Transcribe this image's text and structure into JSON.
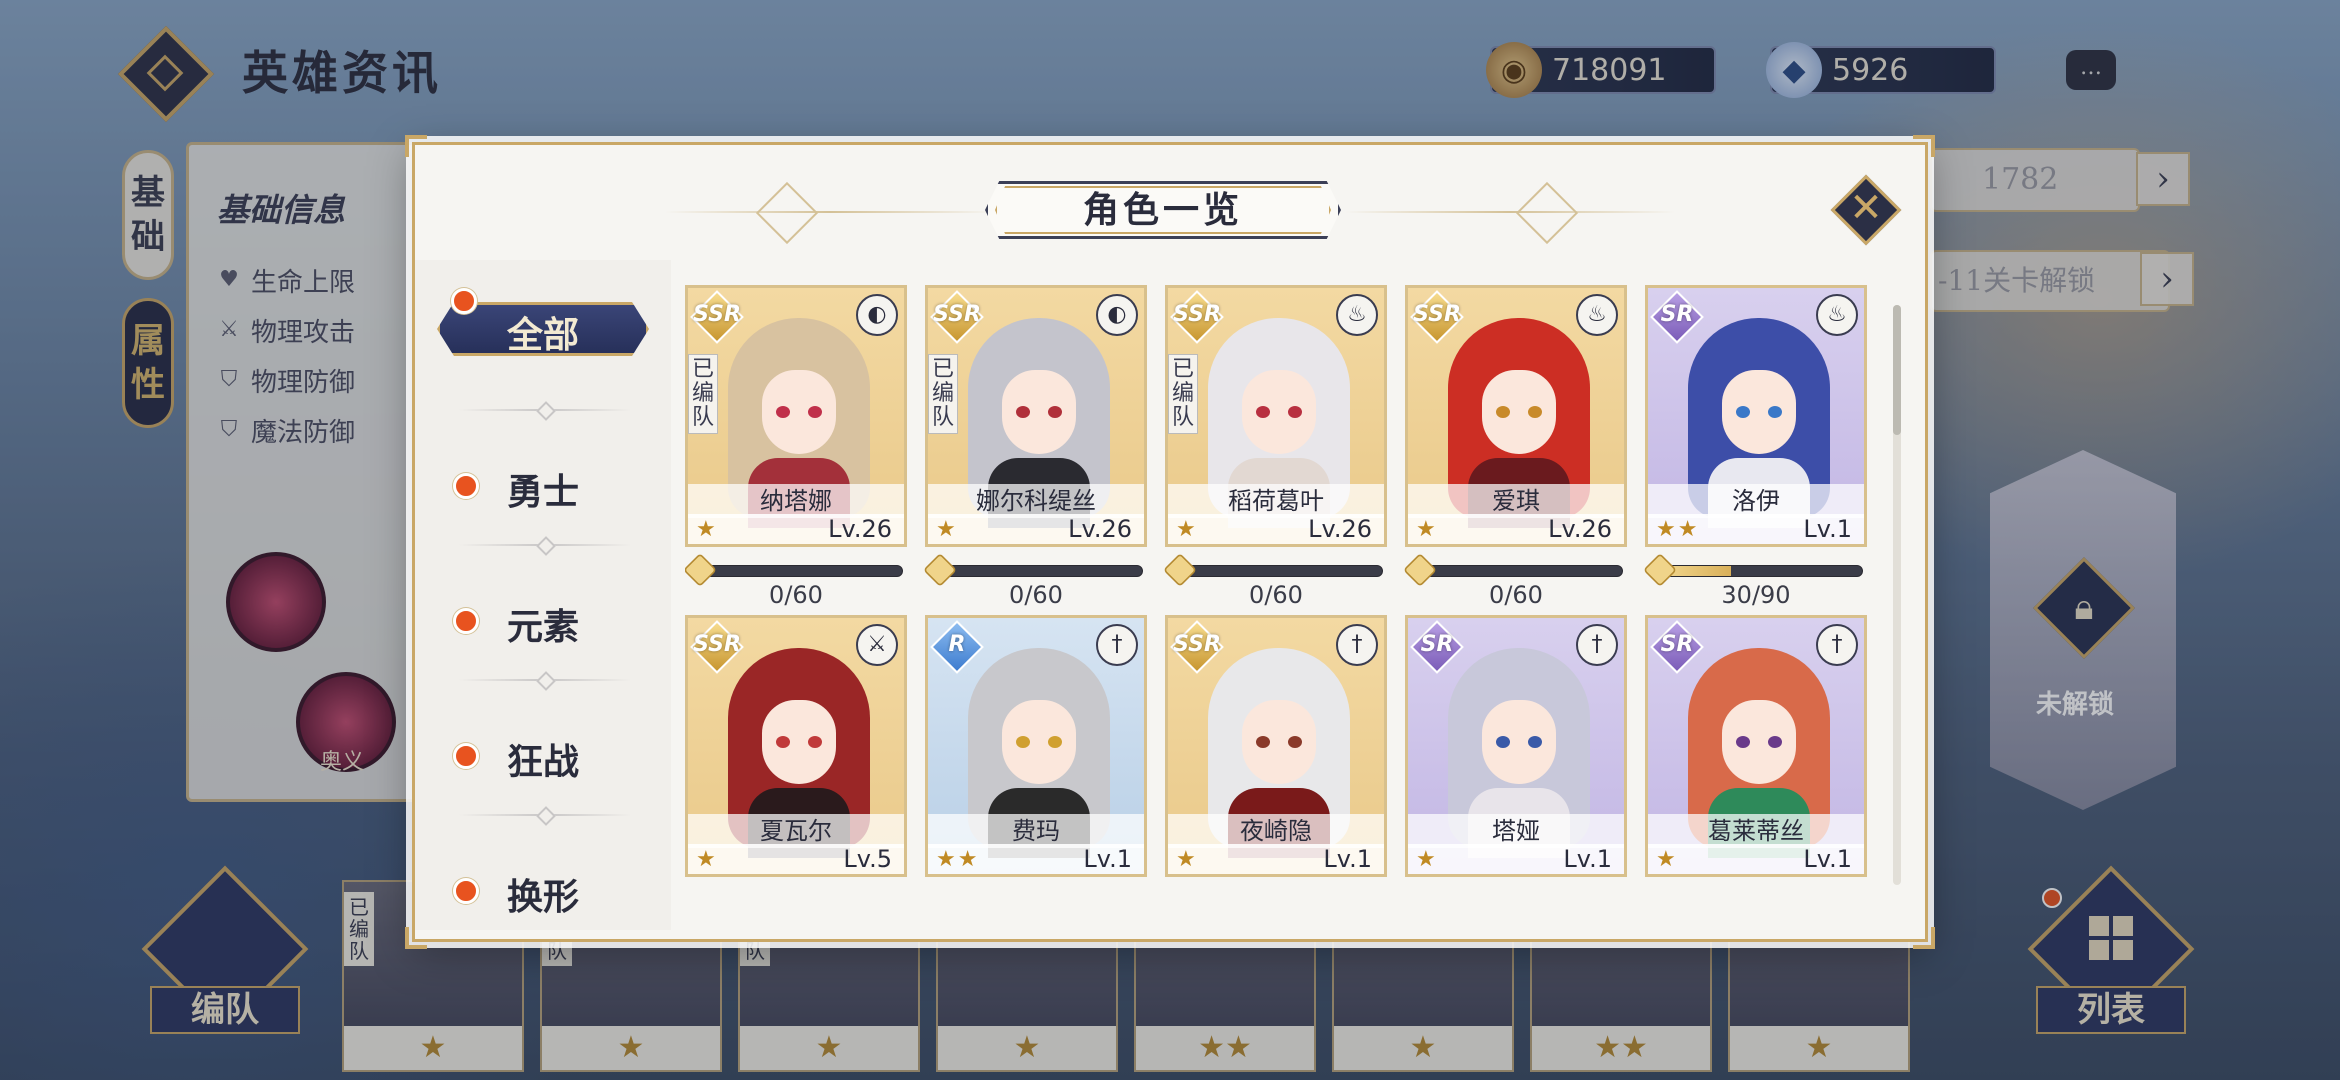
{
  "header": {
    "title": "英雄资讯"
  },
  "currency": {
    "gold": "718091",
    "gems": "5926"
  },
  "side_tabs": [
    "基础",
    "属性"
  ],
  "info_panel": {
    "title": "基础信息",
    "stats": [
      "生命上限",
      "物理攻击",
      "物理防御",
      "魔法防御"
    ],
    "skill_label": "奥义"
  },
  "right_panel": {
    "value": "1782",
    "unlock_text": "-11关卡解锁",
    "locked_label": "未解锁"
  },
  "bottom": {
    "team_label": "编队",
    "list_label": "列表",
    "team_tag": "已编队"
  },
  "modal": {
    "title": "角色一览",
    "close": "✕"
  },
  "filters": [
    "全部",
    "勇士",
    "元素",
    "狂战",
    "换形"
  ],
  "colors": {
    "accent_gold": "#c9a766",
    "navy": "#2b3560",
    "alert": "#e8531f"
  },
  "characters": [
    {
      "rarity": "SSR",
      "name": "纳塔娜",
      "level": "Lv.26",
      "stars": "★",
      "team": "已编队",
      "class_icon": "shield-mask-icon",
      "class_glyph": "◐",
      "progress": "0/60",
      "progress_fraction": 0
    },
    {
      "rarity": "SSR",
      "name": "娜尔科缇丝",
      "level": "Lv.26",
      "stars": "★",
      "team": "已编队",
      "class_icon": "shield-mask-icon",
      "class_glyph": "◐",
      "progress": "0/60",
      "progress_fraction": 0
    },
    {
      "rarity": "SSR",
      "name": "稻荷葛叶",
      "level": "Lv.26",
      "stars": "★",
      "team": "已编队",
      "class_icon": "flame-icon",
      "class_glyph": "♨",
      "progress": "0/60",
      "progress_fraction": 0
    },
    {
      "rarity": "SSR",
      "name": "爱琪",
      "level": "Lv.26",
      "stars": "★",
      "team": "",
      "class_icon": "flame-icon",
      "class_glyph": "♨",
      "progress": "0/60",
      "progress_fraction": 0
    },
    {
      "rarity": "SR",
      "name": "洛伊",
      "level": "Lv.1",
      "stars": "★★",
      "team": "",
      "class_icon": "flame-icon",
      "class_glyph": "♨",
      "progress": "30/90",
      "progress_fraction": 0.333
    },
    {
      "rarity": "SSR",
      "name": "夏瓦尔",
      "level": "Lv.5",
      "stars": "★",
      "team": "",
      "class_icon": "axe-icon",
      "class_glyph": "⚔",
      "progress": "",
      "progress_fraction": null
    },
    {
      "rarity": "R",
      "name": "费玛",
      "level": "Lv.1",
      "stars": "★★",
      "team": "",
      "class_icon": "sword-icon",
      "class_glyph": "†",
      "progress": "",
      "progress_fraction": null
    },
    {
      "rarity": "SSR",
      "name": "夜崎隐",
      "level": "Lv.1",
      "stars": "★",
      "team": "",
      "class_icon": "sword-icon",
      "class_glyph": "†",
      "progress": "",
      "progress_fraction": null
    },
    {
      "rarity": "SR",
      "name": "塔娅",
      "level": "Lv.1",
      "stars": "★",
      "team": "",
      "class_icon": "sword-icon",
      "class_glyph": "†",
      "progress": "",
      "progress_fraction": null
    },
    {
      "rarity": "SR",
      "name": "葛莱蒂丝",
      "level": "Lv.1",
      "stars": "★",
      "team": "",
      "class_icon": "sword-icon",
      "class_glyph": "†",
      "progress": "",
      "progress_fraction": null
    }
  ],
  "bottom_slots": [
    "★",
    "★",
    "★",
    "★",
    "★★",
    "★",
    "★★",
    "★"
  ]
}
